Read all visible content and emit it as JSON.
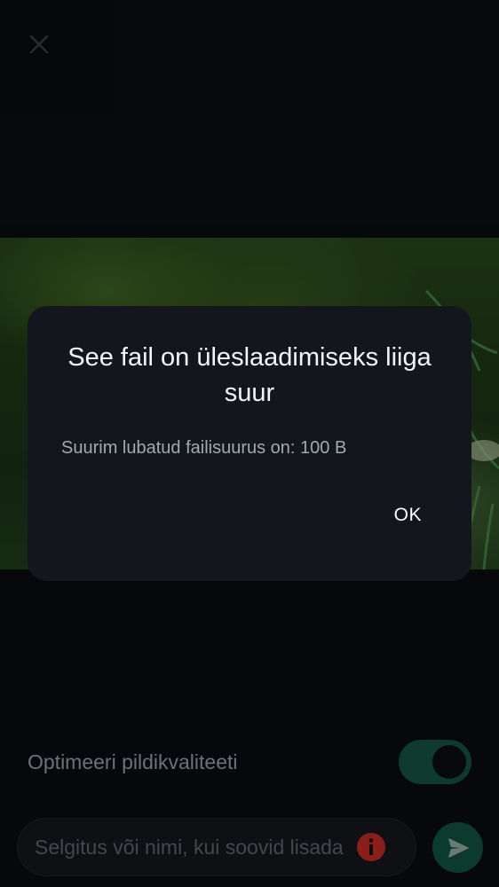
{
  "header": {
    "close_icon": "close-icon"
  },
  "dialog": {
    "title": "See fail on üleslaadimiseks liiga suur",
    "message": "Suurim lubatud failisuurus on: 100 B",
    "ok_label": "OK"
  },
  "options": {
    "optimize_label": "Optimeeri pildikvaliteeti",
    "optimize_enabled": true
  },
  "composer": {
    "caption_text": "Selgitus või nimi, kui soovid lisada",
    "error_icon": "error-icon",
    "send_icon": "send-icon"
  },
  "colors": {
    "background": "#0b0d11",
    "dialog": "#13161c",
    "accent": "#0e3b2e",
    "error": "#b3261e"
  }
}
